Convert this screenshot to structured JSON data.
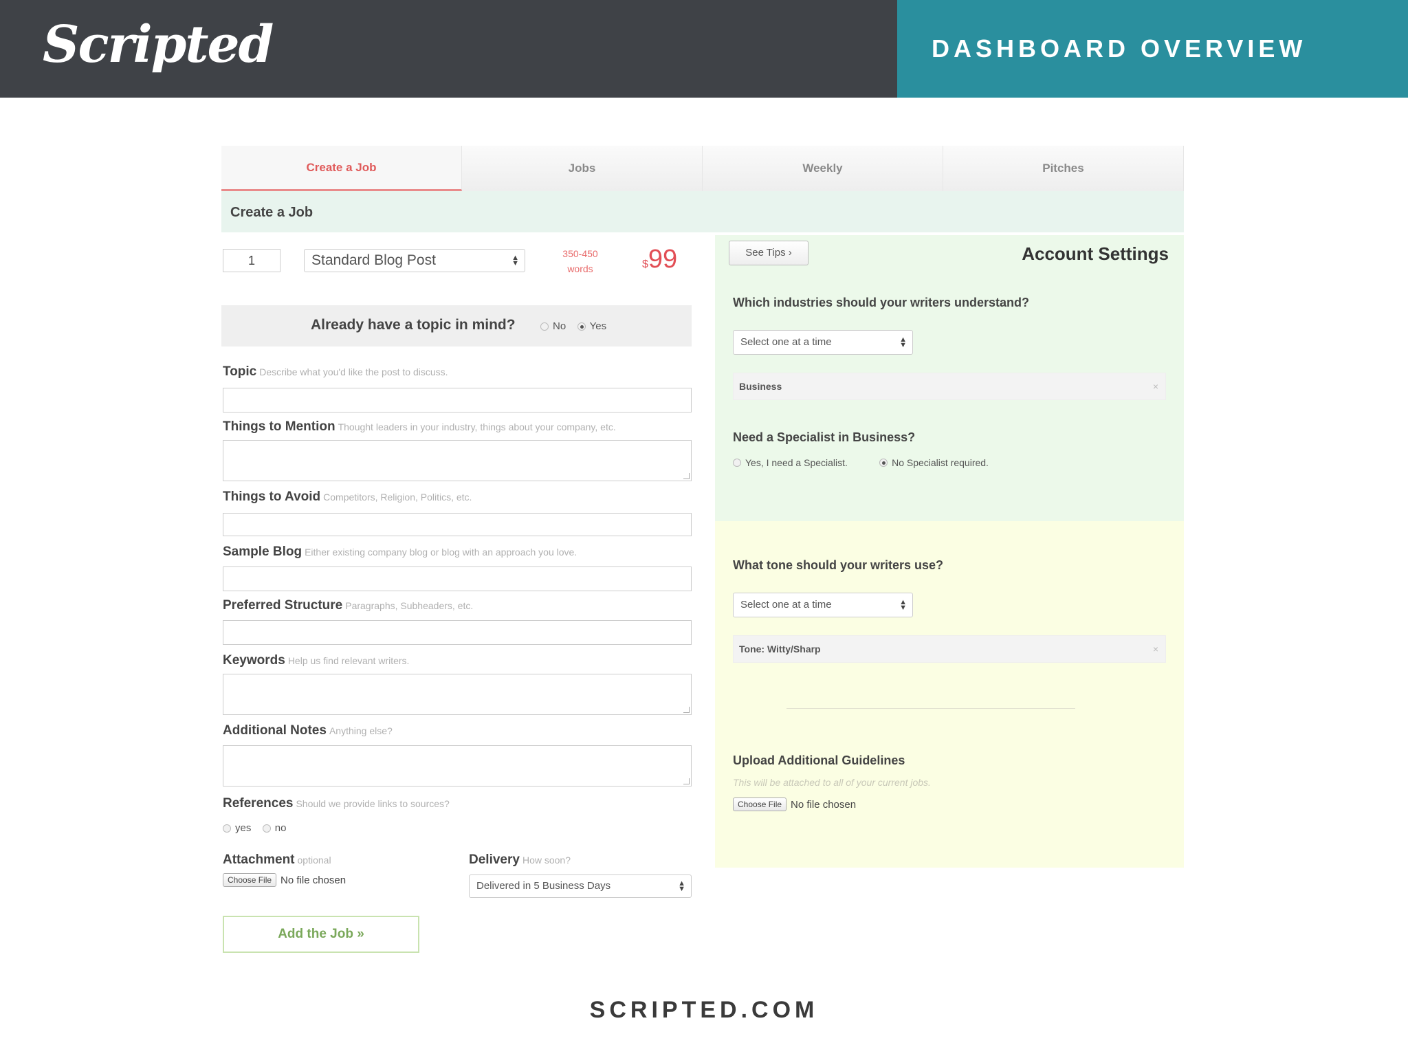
{
  "header": {
    "logo": "Scripted",
    "title": "DASHBOARD OVERVIEW"
  },
  "footer": {
    "url": "SCRIPTED.COM"
  },
  "tabs": [
    {
      "label": "Create a Job",
      "active": true
    },
    {
      "label": "Jobs",
      "active": false
    },
    {
      "label": "Weekly",
      "active": false
    },
    {
      "label": "Pitches",
      "active": false
    }
  ],
  "section_title": "Create a Job",
  "job": {
    "quantity": "1",
    "type": "Standard Blog Post",
    "word_range": "350-450",
    "word_unit": "words",
    "price_currency": "$",
    "price": "99",
    "topic_question": "Already have a topic in mind?",
    "topic_no": "No",
    "topic_yes": "Yes",
    "topic_selected": "Yes"
  },
  "fields": [
    {
      "label": "Topic",
      "help": "Describe what you'd like the post to discuss."
    },
    {
      "label": "Things to Mention",
      "help": "Thought leaders in your industry, things about your company, etc."
    },
    {
      "label": "Things to Avoid",
      "help": "Competitors, Religion, Politics, etc."
    },
    {
      "label": "Sample Blog",
      "help": "Either existing company blog or blog with an approach you love."
    },
    {
      "label": "Preferred Structure",
      "help": "Paragraphs, Subheaders, etc."
    },
    {
      "label": "Keywords",
      "help": "Help us find relevant writers."
    },
    {
      "label": "Additional Notes",
      "help": "Anything else?"
    },
    {
      "label": "References",
      "help": "Should we provide links to sources?"
    }
  ],
  "references": {
    "yes": "yes",
    "no": "no"
  },
  "attachment": {
    "label": "Attachment",
    "help": "optional",
    "button": "Choose File",
    "status": "No file chosen"
  },
  "delivery": {
    "label": "Delivery",
    "help": "How soon?",
    "selected": "Delivered in 5 Business Days"
  },
  "add_job_button": "Add the Job »",
  "account": {
    "see_tips": "See Tips",
    "title": "Account Settings",
    "industries_question": "Which industries should your writers understand?",
    "industries_placeholder": "Select one at a time",
    "industries_tag": "Business",
    "specialist_question": "Need a Specialist in Business?",
    "specialist_yes": "Yes, I need a Specialist.",
    "specialist_no": "No Specialist required.",
    "specialist_selected": "No Specialist required.",
    "tone_question": "What tone should your writers use?",
    "tone_placeholder": "Select one at a time",
    "tone_tag": "Tone: Witty/Sharp",
    "upload_title": "Upload Additional Guidelines",
    "upload_hint": "This will be attached to all of your current jobs.",
    "upload_button": "Choose File",
    "upload_status": "No file chosen"
  },
  "colors": {
    "header_dark": "#3f4247",
    "header_teal": "#2a8f9e",
    "accent_red": "#e24e55",
    "panel_green": "#ecf9ea",
    "panel_yellow": "#fbfee3"
  }
}
